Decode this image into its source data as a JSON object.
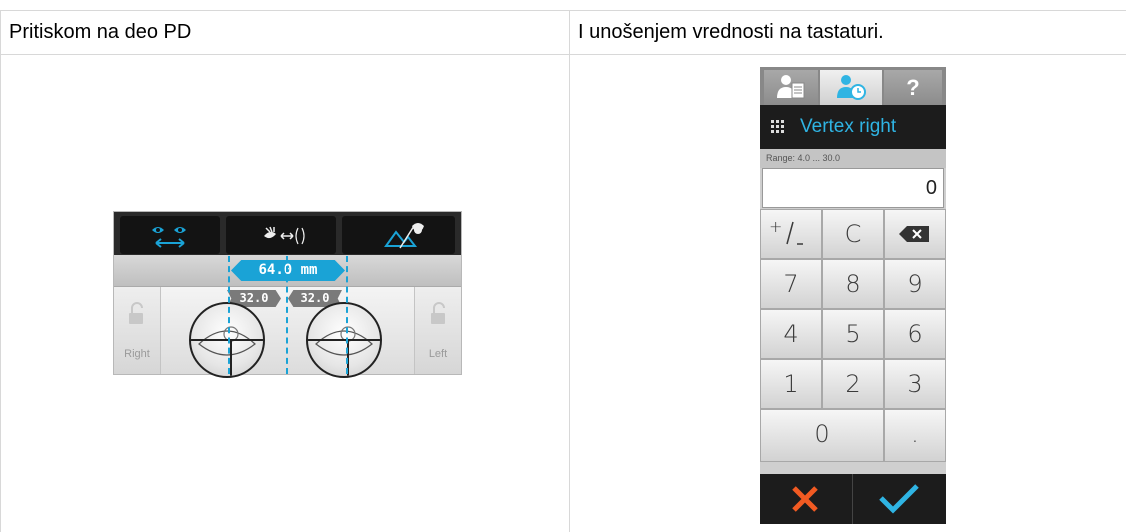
{
  "table": {
    "headers": [
      "Pritiskom na deo PD",
      "I unošenjem vrednosti na tastaturi."
    ]
  },
  "pd_widget": {
    "pd_total": "64.0 mm",
    "right_half": "32.0",
    "left_half": "32.0",
    "right_label": "Right",
    "left_label": "Left",
    "accent": "#1aa3d6"
  },
  "keypad": {
    "tabs": [
      "patient-file-icon",
      "patient-history-icon",
      "help-icon"
    ],
    "help_label": "?",
    "title": "Vertex right",
    "range": "Range: 4.0 ... 30.0",
    "value": "0",
    "keys": [
      "+/-",
      "C",
      "backspace",
      "7",
      "8",
      "9",
      "4",
      "5",
      "6",
      "1",
      "2",
      "3",
      "0",
      "."
    ],
    "cancel_color": "#f15a22",
    "ok_color": "#2fb4e3"
  }
}
